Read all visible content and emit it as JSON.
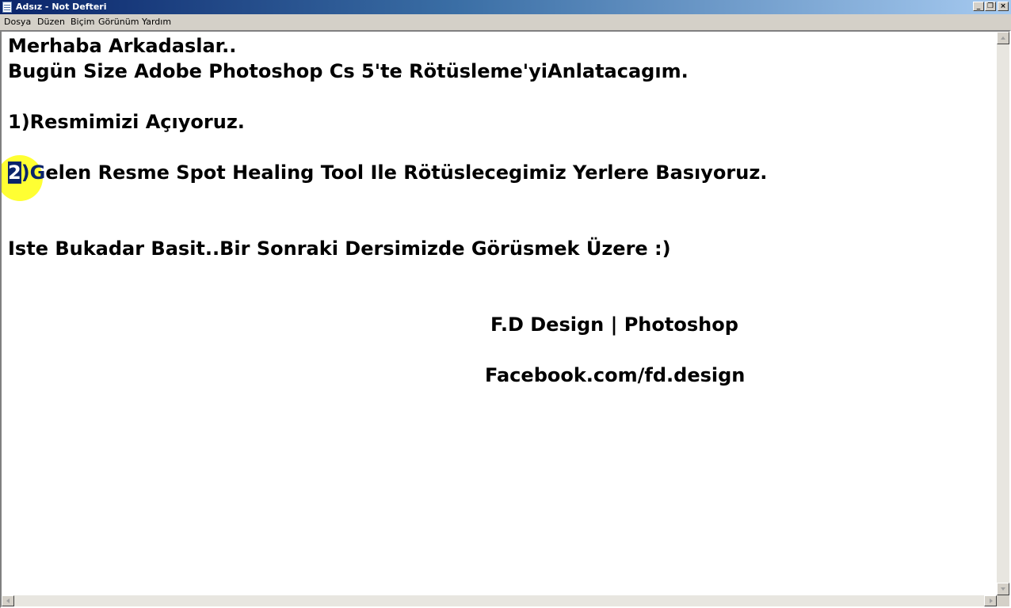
{
  "window": {
    "title": "Adsız - Not Defteri",
    "controls": [
      "minimize-icon",
      "restore-icon",
      "close-icon"
    ]
  },
  "menu": {
    "items": [
      "Dosya",
      "Düzen",
      "Biçim",
      "Görünüm",
      "Yardım"
    ]
  },
  "document": {
    "line1": "Merhaba Arkadaslar..",
    "line2": "Bugün Size Adobe Photoshop Cs 5'te Rötüsleme'yiAnlatacagım.",
    "line3": "1)Resmimizi Açıyoruz.",
    "line4_selected": "2",
    "line4_rest_blue": ")G",
    "line4_rest": "elen Resme Spot Healing Tool Ile Rötüslecegimiz Yerlere Basıyoruz.",
    "line5": "Iste Bukadar Basit..Bir Sonraki Dersimizde Görüsmek Üzere :)",
    "signature": "F.D Design | Photoshop",
    "link": "Facebook.com/fd.design"
  },
  "colors": {
    "selection": "#0a246a",
    "cursor_highlight": "#ffff33",
    "titlebar_start": "#0a246a",
    "titlebar_end": "#a6caf0"
  }
}
